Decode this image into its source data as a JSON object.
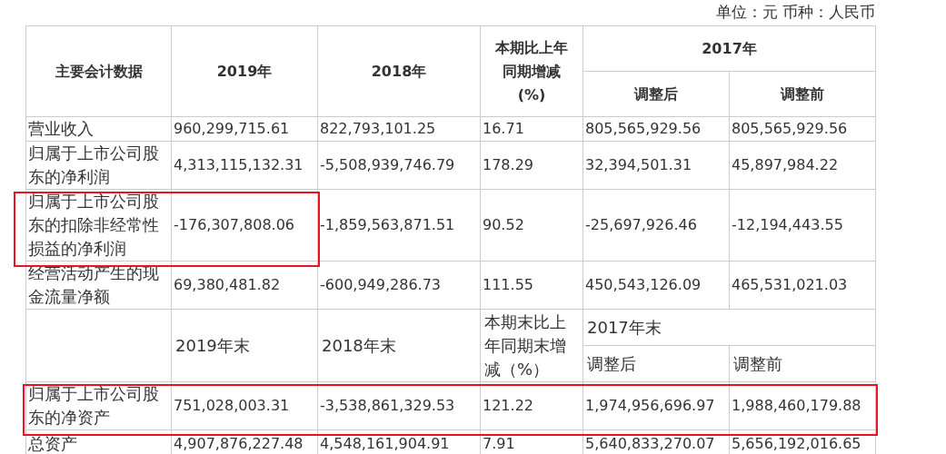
{
  "unit_note": "单位：元 币种：人民币",
  "table": {
    "header": {
      "columns": [
        "主要会计数据",
        "2019年",
        "2018年",
        "本期比上年同期增减(%)",
        "2017年"
      ],
      "subcolumns": [
        "调整后",
        "调整前"
      ]
    },
    "rows": [
      {
        "label": "营业收入",
        "values": [
          "960,299,715.61",
          "822,793,101.25",
          "16.71",
          "805,565,929.56",
          "805,565,929.56"
        ],
        "boxed": [
          false,
          false,
          false,
          false,
          false,
          false
        ]
      },
      {
        "label": "归属于上市公司股东的净利润",
        "values": [
          "4,313,115,132.31",
          "-5,508,939,746.79",
          "178.29",
          "32,394,501.31",
          "45,897,984.22"
        ],
        "boxed": [
          false,
          false,
          false,
          false,
          false,
          false
        ]
      },
      {
        "label": "归属于上市公司股东的扣除非经常性损益的净利润",
        "values": [
          "-176,307,808.06",
          "-1,859,563,871.51",
          "90.52",
          "-25,697,926.46",
          "-12,194,443.55"
        ],
        "boxed": [
          true,
          true,
          false,
          false,
          false,
          false
        ]
      },
      {
        "label": "经营活动产生的现金流量净额",
        "values": [
          "69,380,481.82",
          "-600,949,286.73",
          "111.55",
          "450,543,126.09",
          "465,531,021.03"
        ],
        "boxed": [
          false,
          false,
          false,
          false,
          false,
          false
        ]
      }
    ],
    "balance_header": {
      "columns": [
        "2019年末",
        "2018年末",
        "本期末比上年同期末增减（%）",
        "2017年末"
      ],
      "subcolumns": [
        "调整后",
        "调整前"
      ]
    },
    "balance_rows": [
      {
        "label": "归属于上市公司股东的净资产",
        "values": [
          "751,028,003.31",
          "-3,538,861,329.53",
          "121.22",
          "1,974,956,696.97",
          "1,988,460,179.88"
        ],
        "boxed": [
          true,
          true,
          true,
          true,
          true,
          true
        ]
      },
      {
        "label": "总资产",
        "values": [
          "4,907,876,227.48",
          "4,548,161,904.91",
          "7.91",
          "5,640,833,270.07",
          "5,656,192,016.65"
        ],
        "boxed": [
          false,
          false,
          false,
          false,
          false,
          false
        ]
      }
    ]
  }
}
